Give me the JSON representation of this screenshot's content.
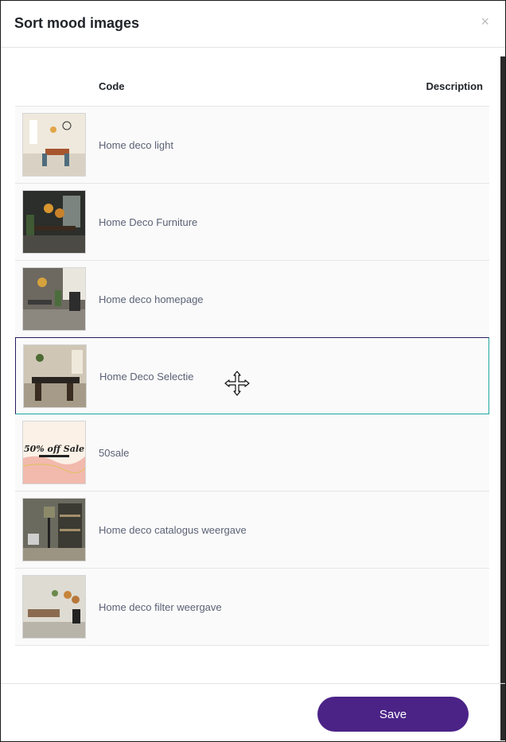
{
  "modal": {
    "title": "Sort mood images",
    "close_symbol": "×"
  },
  "table": {
    "headers": {
      "code": "Code",
      "description": "Description"
    },
    "rows": [
      {
        "label": "Home deco light",
        "image": "dining-room-light-thumbnail"
      },
      {
        "label": "Home Deco Furniture",
        "image": "dark-dining-room-thumbnail"
      },
      {
        "label": "Home deco homepage",
        "image": "living-room-thumbnail"
      },
      {
        "label": "Home Deco Selectie",
        "image": "dining-table-thumbnail"
      },
      {
        "label": "50sale",
        "image": "sale-banner-thumbnail",
        "overlay_text": "50% off Sale"
      },
      {
        "label": "Home deco catalogus weergave",
        "image": "catalog-shelf-thumbnail"
      },
      {
        "label": "Home deco filter weergave",
        "image": "filter-lounge-thumbnail"
      }
    ]
  },
  "footer": {
    "save_label": "Save"
  },
  "colors": {
    "accent": "#4b2387",
    "active_border": "#23a6a0",
    "text_muted": "#5b6275"
  },
  "icons": {
    "drag": "move-cursor-icon",
    "close": "close-icon"
  }
}
